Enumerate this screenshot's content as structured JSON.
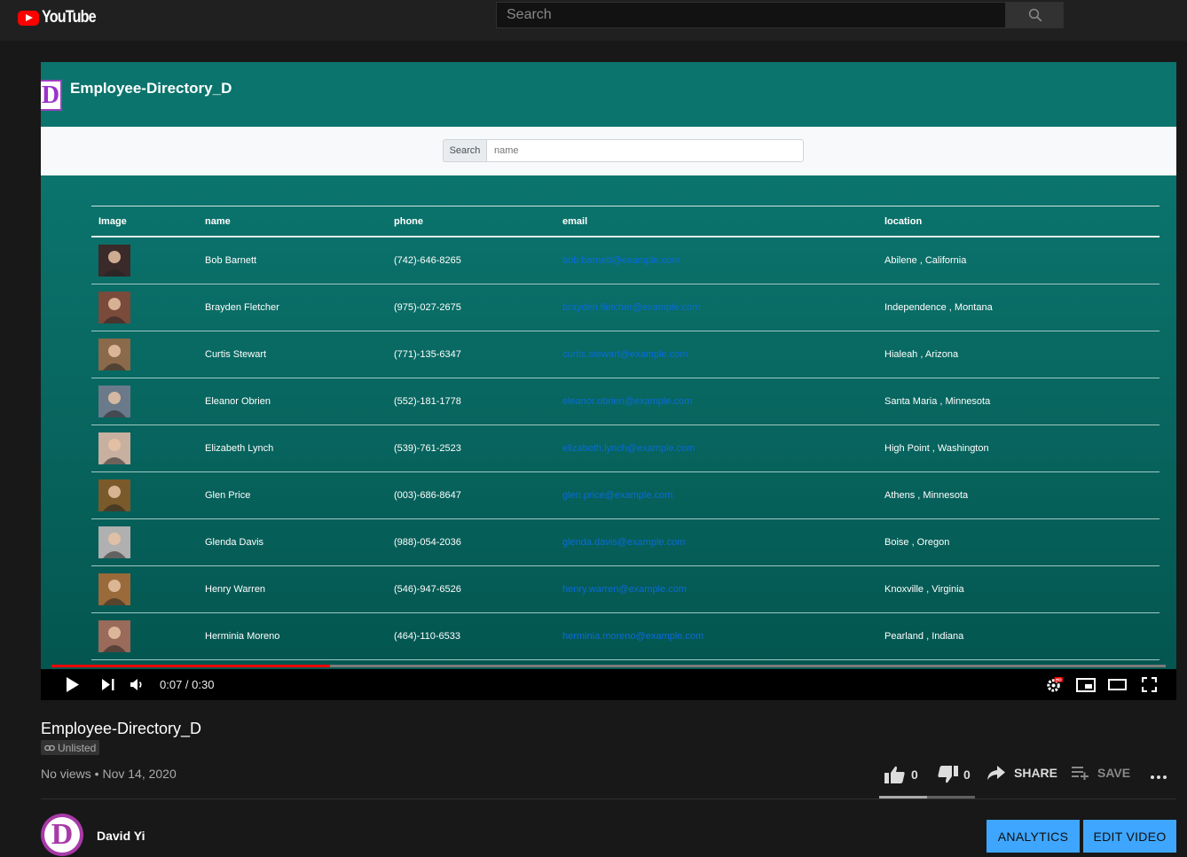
{
  "masthead": {
    "logo_text": "YouTube",
    "search_placeholder": "Search"
  },
  "app": {
    "logo_letter": "D",
    "title": "Employee-Directory_D",
    "search_label": "Search",
    "search_placeholder": "name",
    "columns": [
      "Image",
      "name",
      "phone",
      "email",
      "location"
    ],
    "rows": [
      {
        "name": "Bob Barnett",
        "phone": "(742)-646-8265",
        "email": "bob.barnett@example.com",
        "location": "Abilene , California",
        "avatar_color": "#3a2a2a"
      },
      {
        "name": "Brayden Fletcher",
        "phone": "(975)-027-2675",
        "email": "brayden.fletcher@example.com",
        "location": "Independence , Montana",
        "avatar_color": "#7a4a3a"
      },
      {
        "name": "Curtis Stewart",
        "phone": "(771)-135-6347",
        "email": "curtis.stewart@example.com",
        "location": "Hialeah , Arizona",
        "avatar_color": "#8a6a4a"
      },
      {
        "name": "Eleanor Obrien",
        "phone": "(552)-181-1778",
        "email": "eleanor.obrien@example.com",
        "location": "Santa Maria , Minnesota",
        "avatar_color": "#6a7a8a"
      },
      {
        "name": "Elizabeth Lynch",
        "phone": "(539)-761-2523",
        "email": "elizabeth.lynch@example.com",
        "location": "High Point , Washington",
        "avatar_color": "#c8b0a0"
      },
      {
        "name": "Glen Price",
        "phone": "(003)-686-8647",
        "email": "glen.price@example.com",
        "location": "Athens , Minnesota",
        "avatar_color": "#7a5a2a"
      },
      {
        "name": "Glenda Davis",
        "phone": "(988)-054-2036",
        "email": "glenda.davis@example.com",
        "location": "Boise , Oregon",
        "avatar_color": "#b0b0b0"
      },
      {
        "name": "Henry Warren",
        "phone": "(546)-947-6526",
        "email": "henry.warren@example.com",
        "location": "Knoxville , Virginia",
        "avatar_color": "#9a6a3a"
      },
      {
        "name": "Herminia Moreno",
        "phone": "(464)-110-6533",
        "email": "herminia.moreno@example.com",
        "location": "Pearland , Indiana",
        "avatar_color": "#9a6a5a"
      }
    ]
  },
  "player": {
    "time": "0:07 / 0:30",
    "progress": 0.25
  },
  "video": {
    "title": "Employee-Directory_D",
    "visibility": "Unlisted",
    "meta": "No views • Nov 14, 2020",
    "likes": "0",
    "dislikes": "0",
    "share_label": "SHARE",
    "save_label": "SAVE"
  },
  "channel": {
    "name": "David Yi",
    "avatar_letter": "D"
  },
  "buttons": {
    "analytics": "ANALYTICS",
    "edit_video": "EDIT VIDEO"
  },
  "colors": {
    "app_header": "#0b746d",
    "accent_blue": "#3ea6ff",
    "brand_red": "#ff0000"
  }
}
